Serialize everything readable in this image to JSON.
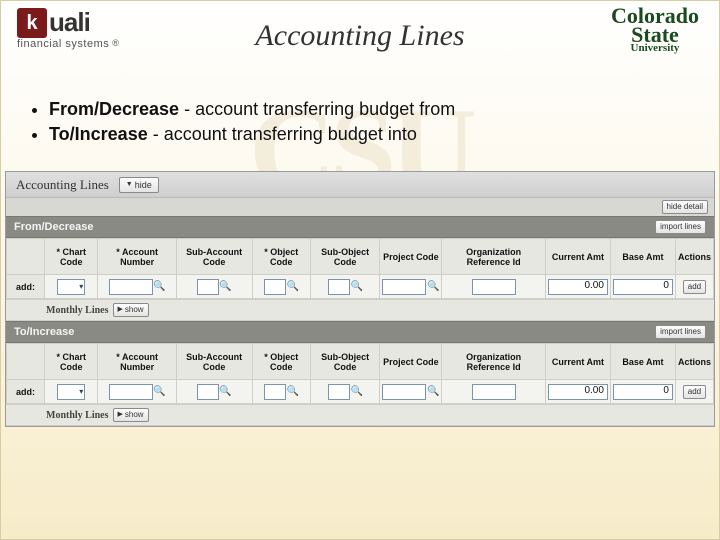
{
  "logos": {
    "kuali_k": "k",
    "kuali_word": "uali",
    "kuali_sub": "financial systems",
    "csu_top": "Colorado",
    "csu_bot": "State",
    "csu_uni": "University"
  },
  "title": "Accounting Lines",
  "watermark": "CSU",
  "bullets": [
    {
      "bold": "From/Decrease",
      "rest": " - account transferring budget from"
    },
    {
      "bold": "To/Increase",
      "rest": " - account transferring budget into"
    }
  ],
  "panel": {
    "header_title": "Accounting Lines",
    "hide_label": "hide",
    "hide_detail_label": "hide detail",
    "import_lines_label": "import lines",
    "add_button_label": "add",
    "add_row_label": "add:",
    "monthly_lines_label": "Monthly Lines",
    "show_label": "show",
    "sections": {
      "from": "From/Decrease",
      "to": "To/Increase"
    },
    "columns": [
      "* Chart Code",
      "* Account Number",
      "Sub-Account Code",
      "* Object Code",
      "Sub-Object Code",
      "Project Code",
      "Organization Reference Id",
      "Current Amt",
      "Base Amt",
      "Actions"
    ],
    "defaults": {
      "current_amt": "0.00",
      "base_amt": "0"
    }
  }
}
